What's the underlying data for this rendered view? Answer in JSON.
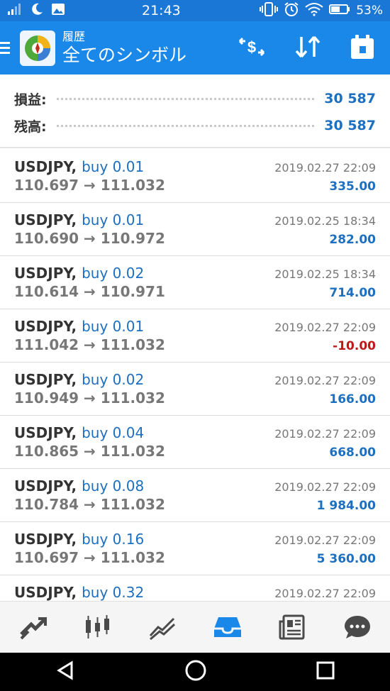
{
  "status_bar": {
    "time": "21:43",
    "battery": "53%"
  },
  "app_bar": {
    "subtitle": "履歴",
    "title": "全てのシンボル",
    "icons": [
      "menu-icon",
      "app-logo-icon",
      "currency-exchange-icon",
      "sort-icon",
      "calendar-icon"
    ]
  },
  "summary": {
    "profit_label": "損益:",
    "profit_value": "30 587",
    "balance_label": "残高:",
    "balance_value": "30 587"
  },
  "trades": [
    {
      "symbol": "USDJPY,",
      "side": "buy 0.01",
      "prices": "110.697 → 111.032",
      "date": "2019.02.27 22:09",
      "profit": "335.00",
      "negative": false
    },
    {
      "symbol": "USDJPY,",
      "side": "buy 0.01",
      "prices": "110.690 → 110.972",
      "date": "2019.02.25 18:34",
      "profit": "282.00",
      "negative": false
    },
    {
      "symbol": "USDJPY,",
      "side": "buy 0.02",
      "prices": "110.614 → 110.971",
      "date": "2019.02.25 18:34",
      "profit": "714.00",
      "negative": false
    },
    {
      "symbol": "USDJPY,",
      "side": "buy 0.01",
      "prices": "111.042 → 111.032",
      "date": "2019.02.27 22:09",
      "profit": "-10.00",
      "negative": true
    },
    {
      "symbol": "USDJPY,",
      "side": "buy 0.02",
      "prices": "110.949 → 111.032",
      "date": "2019.02.27 22:09",
      "profit": "166.00",
      "negative": false
    },
    {
      "symbol": "USDJPY,",
      "side": "buy 0.04",
      "prices": "110.865 → 111.032",
      "date": "2019.02.27 22:09",
      "profit": "668.00",
      "negative": false
    },
    {
      "symbol": "USDJPY,",
      "side": "buy 0.08",
      "prices": "110.784 → 111.032",
      "date": "2019.02.27 22:09",
      "profit": "1 984.00",
      "negative": false
    },
    {
      "symbol": "USDJPY,",
      "side": "buy 0.16",
      "prices": "110.697 → 111.032",
      "date": "2019.02.27 22:09",
      "profit": "5 360.00",
      "negative": false
    },
    {
      "symbol": "USDJPY,",
      "side": "buy 0.32",
      "prices": "",
      "date": "2019.02.27 22:09",
      "profit": "",
      "negative": false
    }
  ],
  "bottom_nav": [
    "trade-icon",
    "chart-candles-icon",
    "chart-line-icon",
    "history-inbox-icon",
    "news-icon",
    "chat-icon"
  ],
  "system_nav": [
    "back-icon",
    "home-icon",
    "recents-icon"
  ],
  "colors": {
    "status_bar": "#1a77d6",
    "app_bar": "#1a88e8",
    "accent": "#1d6fc0",
    "negative": "#c01818",
    "active_nav": "#1a88e8"
  }
}
